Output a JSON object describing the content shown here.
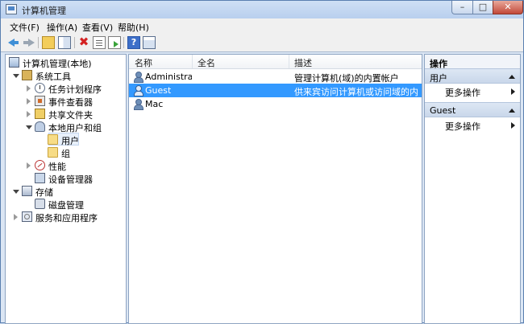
{
  "window": {
    "title": "计算机管理"
  },
  "titlebar": {
    "min_glyph": "–",
    "max_glyph": "□",
    "close_glyph": "✕"
  },
  "menu": [
    "文件(F)",
    "操作(A)",
    "查看(V)",
    "帮助(H)"
  ],
  "toolbar": {
    "delete_glyph": "✖",
    "help_glyph": "?"
  },
  "tree": {
    "root": "计算机管理(本地)",
    "system_tools": "系统工具",
    "task_scheduler": "任务计划程序",
    "event_viewer": "事件查看器",
    "shared_folders": "共享文件夹",
    "local_users_groups": "本地用户和组",
    "users": "用户",
    "groups": "组",
    "performance": "性能",
    "device_manager": "设备管理器",
    "storage": "存储",
    "disk_management": "磁盘管理",
    "services_apps": "服务和应用程序"
  },
  "list": {
    "columns": [
      "名称",
      "全名",
      "描述"
    ],
    "rows": [
      {
        "name": "Administrat...",
        "full_name": "",
        "description": "管理计算机(域)的内置帐户",
        "selected": false
      },
      {
        "name": "Guest",
        "full_name": "",
        "description": "供来宾访问计算机或访问域的内...",
        "selected": true
      },
      {
        "name": "Mac",
        "full_name": "",
        "description": "",
        "selected": false
      }
    ]
  },
  "actions": {
    "header": "操作",
    "sections": [
      {
        "title": "用户",
        "item": "更多操作"
      },
      {
        "title": "Guest",
        "item": "更多操作"
      }
    ]
  }
}
